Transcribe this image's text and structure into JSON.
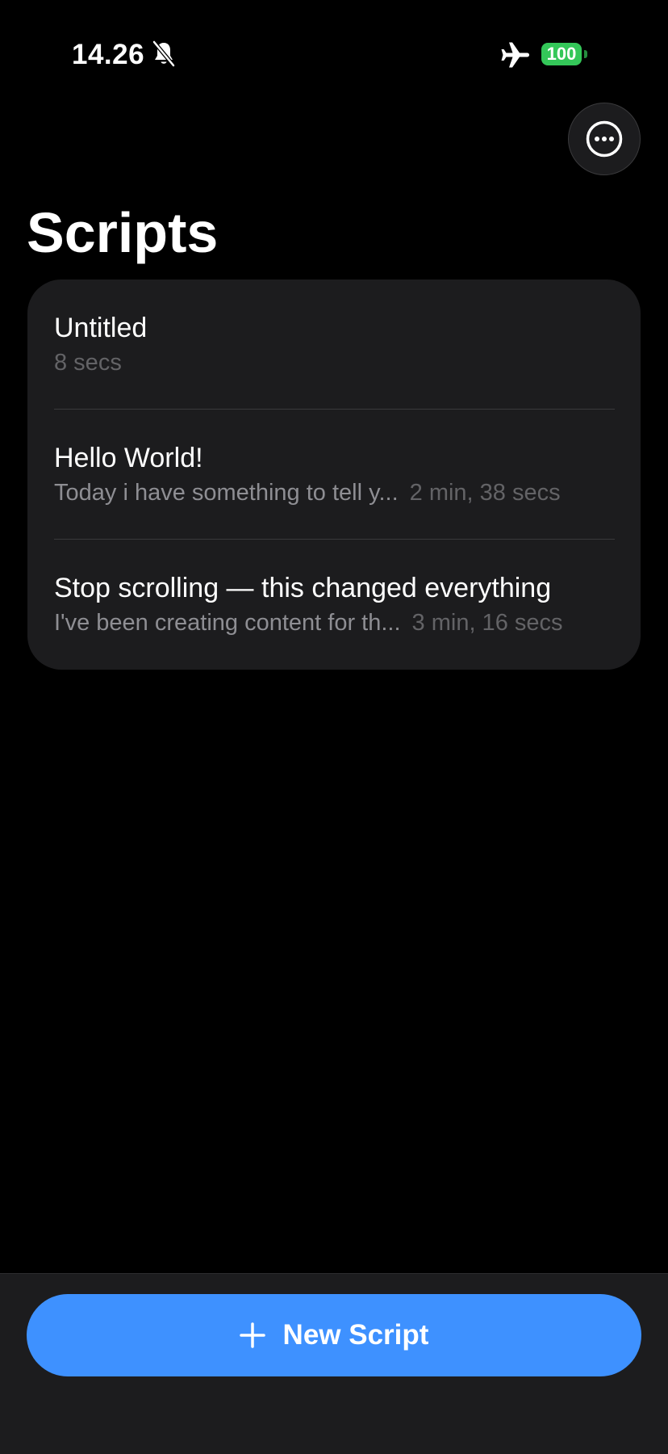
{
  "status_bar": {
    "time": "14.26",
    "battery": "100",
    "icons": [
      "bell-slash-icon",
      "airplane-icon",
      "battery-icon"
    ]
  },
  "header": {
    "title": "Scripts",
    "more_icon": "ellipsis-circle-icon"
  },
  "scripts": [
    {
      "title": "Untitled",
      "preview": "",
      "duration": "8 secs"
    },
    {
      "title": "Hello World!",
      "preview": "Today i have something to tell y...",
      "duration": "2 min, 38 secs"
    },
    {
      "title": "Stop scrolling — this changed everything",
      "preview": "I've been creating content for th...",
      "duration": "3 min, 16 secs"
    }
  ],
  "footer": {
    "new_script_label": "New Script",
    "new_script_icon": "plus-icon"
  },
  "colors": {
    "background": "#000000",
    "card": "#1c1c1e",
    "accent": "#3e91ff",
    "battery": "#34c759",
    "secondary_text": "#8e8e93",
    "tertiary_text": "#636366"
  }
}
